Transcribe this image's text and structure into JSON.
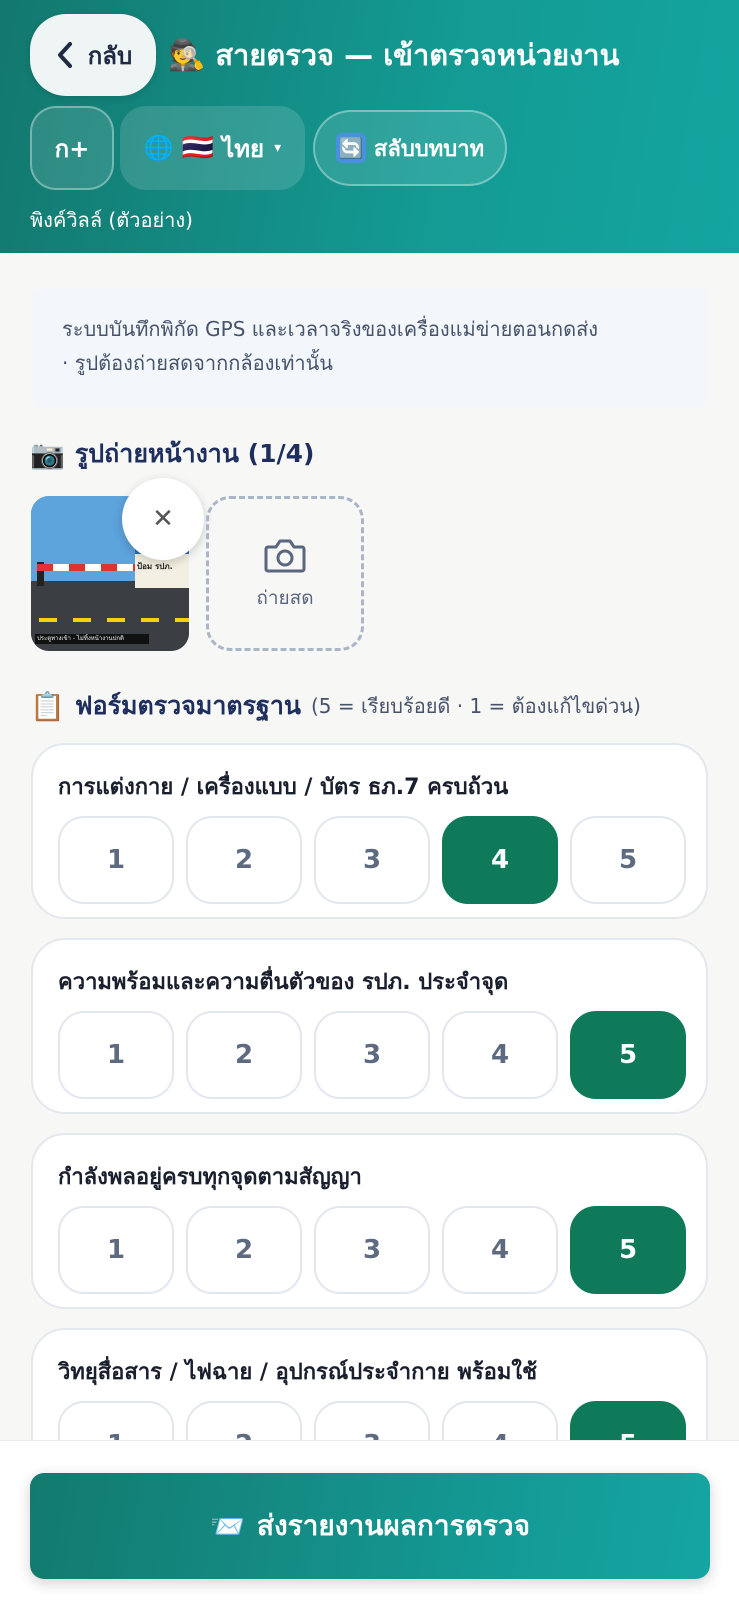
{
  "header": {
    "back_label": "กลับ",
    "title_icon": "detective-emoji",
    "title_icon_glyph": "🕵️",
    "title": "สายตรวจ — เข้าตรวจหน่วยงาน",
    "font_size_label": "ก+",
    "language": {
      "globe": "🌐",
      "flag": "🇹🇭",
      "label": "ไทย",
      "caret": "▾"
    },
    "switch_role": {
      "icon_glyph": "🔄",
      "label": "สลับบทบาท"
    },
    "org_name": "พิงค์วิลล์ (ตัวอย่าง)"
  },
  "notice": {
    "line1": "ระบบบันทึกพิกัด GPS และเวลาจริงของเครื่องแม่ข่ายตอนกดส่ง",
    "line2": "· รูปต้องถ่ายสดจากกล้องเท่านั้น"
  },
  "photos": {
    "icon_glyph": "📷",
    "title": "รูปถ่ายหน้างาน (1/4)",
    "thumbnail": {
      "sign_text": "ป้อม รปภ.",
      "caption": "ประตูทางเข้า - ไม่ทิ้งหน้างานปกติ"
    },
    "remove_glyph": "✕",
    "capture_label": "ถ่ายสด"
  },
  "form": {
    "icon_glyph": "📋",
    "title": "ฟอร์มตรวจมาตรฐาน",
    "hint": "(5 = เรียบร้อยดี · 1 = ต้องแก้ไขด่วน)",
    "scale": [
      "1",
      "2",
      "3",
      "4",
      "5"
    ],
    "items": [
      {
        "question": "การแต่งกาย / เครื่องแบบ / บัตร ธภ.7 ครบถ้วน",
        "selected": 4
      },
      {
        "question": "ความพร้อมและความตื่นตัวของ รปภ. ประจำจุด",
        "selected": 5
      },
      {
        "question": "กำลังพลอยู่ครบทุกจุดตามสัญญา",
        "selected": 5
      },
      {
        "question": "วิทยุสื่อสาร / ไฟฉาย / อุปกรณ์ประจำกาย พร้อมใช้",
        "selected": 5
      }
    ]
  },
  "submit": {
    "icon_glyph": "📨",
    "label": "ส่งรายงานผลการตรวจ"
  },
  "colors": {
    "header_teal": "#139b94",
    "selected_green": "#0f7a5a",
    "title_navy": "#1e2f5e"
  }
}
